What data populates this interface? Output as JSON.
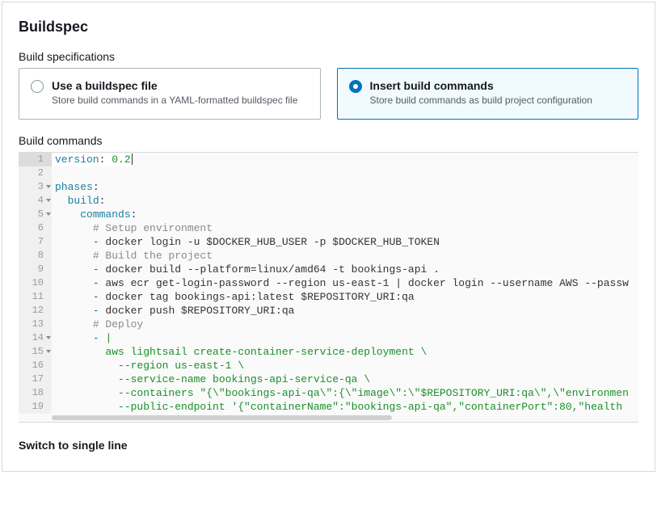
{
  "panel": {
    "title": "Buildspec"
  },
  "spec_section": {
    "label": "Build specifications",
    "options": [
      {
        "title": "Use a buildspec file",
        "desc": "Store build commands in a YAML-formatted buildspec file",
        "selected": false
      },
      {
        "title": "Insert build commands",
        "desc": "Store build commands as build project configuration",
        "selected": true
      }
    ]
  },
  "commands_section": {
    "label": "Build commands"
  },
  "code_lines": [
    {
      "n": 1,
      "fold": false,
      "html": "<span class='tok-key'>version</span><span class='tok-punc'>:</span> <span class='tok-num'>0.2</span><span class='cursor'></span>"
    },
    {
      "n": 2,
      "fold": false,
      "html": ""
    },
    {
      "n": 3,
      "fold": true,
      "html": "<span class='tok-key'>phases</span><span class='tok-punc'>:</span>"
    },
    {
      "n": 4,
      "fold": true,
      "html": "  <span class='tok-key'>build</span><span class='tok-punc'>:</span>"
    },
    {
      "n": 5,
      "fold": true,
      "html": "    <span class='tok-key'>commands</span><span class='tok-punc'>:</span>"
    },
    {
      "n": 6,
      "fold": false,
      "html": "      <span class='tok-comment'># Setup environment</span>"
    },
    {
      "n": 7,
      "fold": false,
      "html": "      <span class='tok-dash'>-</span> docker login -u $DOCKER_HUB_USER -p $DOCKER_HUB_TOKEN"
    },
    {
      "n": 8,
      "fold": false,
      "html": "      <span class='tok-comment'># Build the project</span>"
    },
    {
      "n": 9,
      "fold": false,
      "html": "      <span class='tok-dash'>-</span> docker build --platform=linux/amd64 -t bookings-api ."
    },
    {
      "n": 10,
      "fold": false,
      "html": "      <span class='tok-dash'>-</span> aws ecr get-login-password --region us-east-1 | docker login --username AWS --passw"
    },
    {
      "n": 11,
      "fold": false,
      "html": "      <span class='tok-dash'>-</span> docker tag bookings-api:latest $REPOSITORY_URI:qa"
    },
    {
      "n": 12,
      "fold": false,
      "html": "      <span class='tok-dash'>-</span> docker push $REPOSITORY_URI:qa"
    },
    {
      "n": 13,
      "fold": false,
      "html": "      <span class='tok-comment'># Deploy</span>"
    },
    {
      "n": 14,
      "fold": true,
      "html": "      <span class='tok-dash'>-</span> <span class='tok-str'>|</span>"
    },
    {
      "n": 15,
      "fold": true,
      "html": "        <span class='tok-str'>aws lightsail create-container-service-deployment \\</span>"
    },
    {
      "n": 16,
      "fold": false,
      "html": "          <span class='tok-str'>--region us-east-1 \\</span>"
    },
    {
      "n": 17,
      "fold": false,
      "html": "          <span class='tok-str'>--service-name bookings-api-service-qa \\</span>"
    },
    {
      "n": 18,
      "fold": false,
      "html": "          <span class='tok-str'>--containers \"{\\\"bookings-api-qa\\\":{\\\"image\\\":\\\"$REPOSITORY_URI:qa\\\",\\\"environmen</span>"
    },
    {
      "n": 19,
      "fold": false,
      "html": "          <span class='tok-str'>--public-endpoint '{\"containerName\":\"bookings-api-qa\",\"containerPort\":80,\"health</span>"
    }
  ],
  "switch_link": {
    "label": "Switch to single line"
  }
}
